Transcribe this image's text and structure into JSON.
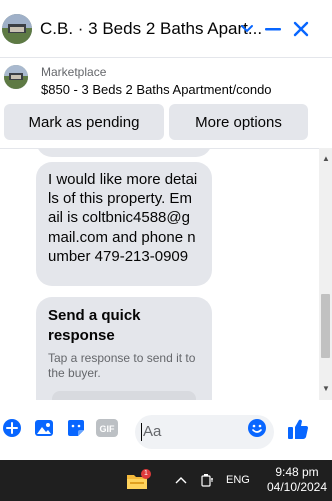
{
  "header": {
    "title": "C.B. · 3 Beds 2 Baths Apart...",
    "icons": {
      "expand": "chevron-down-icon",
      "minimize": "minus-icon",
      "close": "close-icon"
    },
    "accent": "#0866ff"
  },
  "listing": {
    "label": "Marketplace",
    "title": "$850 - 3 Beds 2 Baths Apartment/condo"
  },
  "actions": {
    "mark_pending": "Mark as pending",
    "more_options": "More options"
  },
  "messages": [
    {
      "text": "I would like more details of this property. Email is coltbnic4588@gmail.com and phone number 479-213-0909"
    }
  ],
  "quick_response": {
    "title": "Send a quick response",
    "subtitle": "Tap a response to send it to the buyer."
  },
  "composer": {
    "placeholder": "Aa",
    "icons": [
      "plus-circle-icon",
      "image-icon",
      "sticker-icon",
      "gif-icon",
      "emoji-icon",
      "thumbs-up-icon"
    ]
  },
  "taskbar": {
    "notification_count": "1",
    "language": "ENG",
    "time": "9:48 pm",
    "date": "04/10/2024"
  }
}
